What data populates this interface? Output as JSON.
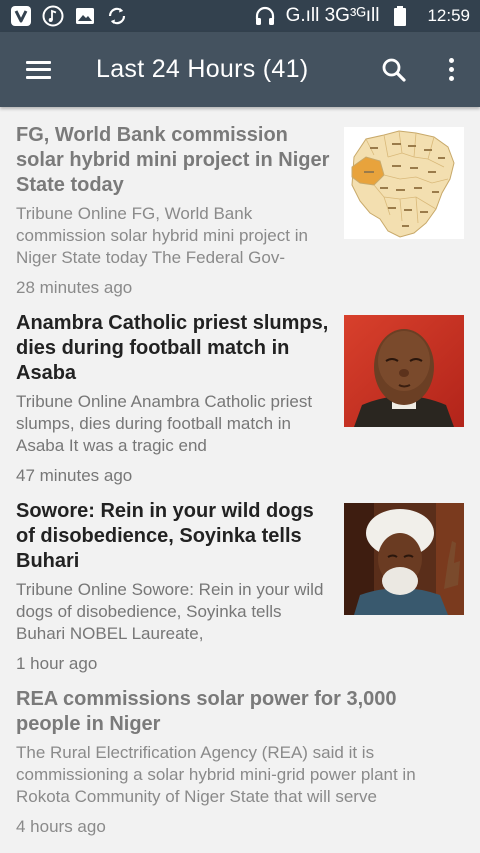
{
  "status_bar": {
    "network": "G.ıll 3G³ᴳıll",
    "time": "12:59",
    "left_icons": [
      "v-app-icon",
      "music-icon",
      "image-icon",
      "sync-icon"
    ],
    "right_icons": [
      "headphones-icon",
      "signal-icon",
      "battery-icon"
    ]
  },
  "app_bar": {
    "title": "Last 24 Hours (41)",
    "menu_icon": "hamburger-menu-icon",
    "search_icon": "search-icon",
    "more_icon": "more-vert-icon",
    "background": "#44525f"
  },
  "articles": [
    {
      "title": "FG, World Bank commission solar hybrid mini project in Niger State today",
      "summary": "Tribune Online FG, World Bank commission solar hybrid mini project in Niger State today The Federal Gov-",
      "time": "28 minutes ago",
      "read": true,
      "image": "map-of-nigeria-niger-state-highlighted"
    },
    {
      "title": "Anambra Catholic priest slumps, dies during football match in Asaba",
      "summary": "Tribune Online Anambra Catholic priest slumps, dies during football match in Asaba It was a tragic end",
      "time": "47 minutes ago",
      "read": false,
      "image": "portrait-of-priest"
    },
    {
      "title": "Sowore: Rein in your wild dogs of disobedience, Soyinka tells Buhari",
      "summary": "Tribune Online Sowore: Rein in your wild dogs of disobedience, Soyinka tells Buhari   NOBEL Laureate,",
      "time": "1 hour ago",
      "read": false,
      "image": "portrait-of-soyinka"
    },
    {
      "title": "REA commissions solar power for 3,000 people in Niger",
      "summary": "The Rural Electrification Agency (REA) said it is commissioning a solar hybrid mini-grid power plant in Rokota Community of Niger State that will serve",
      "time": "4 hours ago",
      "read": true,
      "image": null
    }
  ]
}
